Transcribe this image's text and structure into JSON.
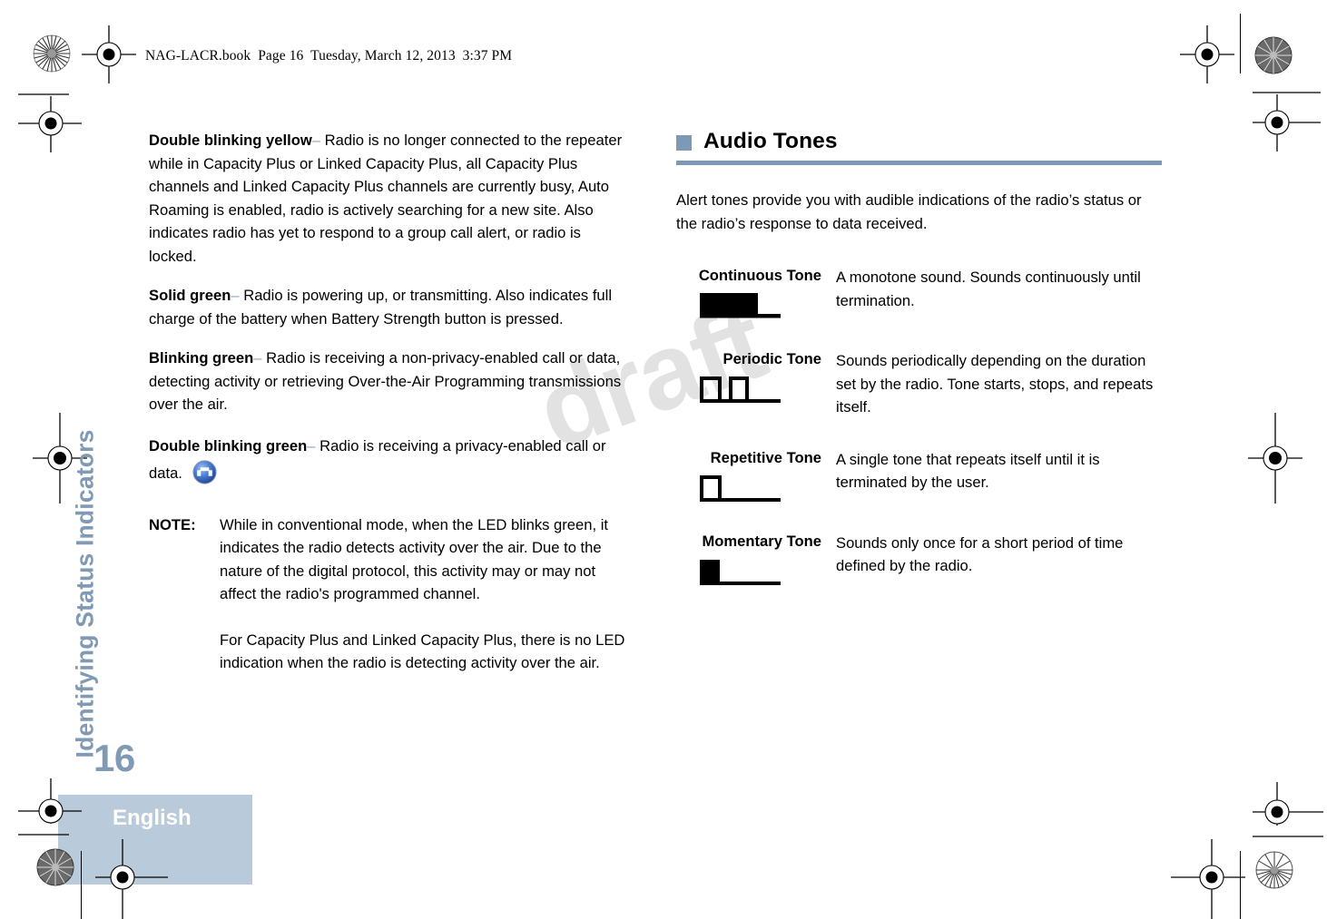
{
  "header": {
    "file_line": "NAG-LACR.book  Page 16  Tuesday, March 12, 2013  3:37 PM"
  },
  "sidebar": {
    "running_head": "Identifying Status Indicators",
    "page_number": "16",
    "language": "English",
    "accent_color": "#8099b4",
    "band_color": "#b9cadb"
  },
  "watermark": {
    "text": "draft",
    "color": "#e2e2e2"
  },
  "left_column": {
    "paragraphs": [
      {
        "term": "Double blinking yellow",
        "dash": "–",
        "text": " Radio is no longer connected to the repeater while in Capacity Plus or Linked Capacity Plus, all Capacity Plus channels and Linked Capacity Plus channels are currently busy, Auto Roaming is enabled, radio is actively searching for a new site. Also indicates radio has yet to respond to a group call alert, or radio is locked."
      },
      {
        "term": "Solid green",
        "dash": "–",
        "text": " Radio is powering up, or transmitting. Also indicates full charge of the battery when Battery Strength button is pressed."
      },
      {
        "term": "Blinking green",
        "dash": "–",
        "text": " Radio is receiving a non-privacy-enabled call or data, detecting activity or retrieving Over-the-Air Programming transmissions over the air."
      },
      {
        "term": "Double blinking green",
        "dash": "–",
        "text": " Radio is receiving a privacy-enabled call or data. ",
        "icon": "privacy-pulse-icon"
      }
    ],
    "note": {
      "label": "NOTE:",
      "paragraph1": "While in conventional mode, when the LED blinks green, it indicates the radio detects activity over the air. Due to the nature of the digital protocol, this activity may or may not affect the radio's programmed channel.",
      "paragraph2": "For Capacity Plus and Linked Capacity Plus, there is no LED indication when the radio is detecting activity over the air."
    }
  },
  "right_column": {
    "heading": "Audio Tones",
    "heading_accent_color": "#7c99b6",
    "intro": "Alert tones provide you with audible indications of the radio’s status or the radio’s response to data received.",
    "tones": [
      {
        "name": "Continuous Tone",
        "waveform": "continuous-waveform-icon",
        "description": "A monotone sound. Sounds continuously until termination."
      },
      {
        "name": "Periodic Tone",
        "waveform": "periodic-waveform-icon",
        "description": "Sounds periodically depending on the duration set by the radio. Tone starts, stops, and repeats itself."
      },
      {
        "name": "Repetitive Tone",
        "waveform": "repetitive-waveform-icon",
        "description": "A single tone that repeats itself until it is terminated by the user."
      },
      {
        "name": "Momentary Tone",
        "waveform": "momentary-waveform-icon",
        "description": "Sounds only once for a short period of time defined by the radio."
      }
    ]
  }
}
